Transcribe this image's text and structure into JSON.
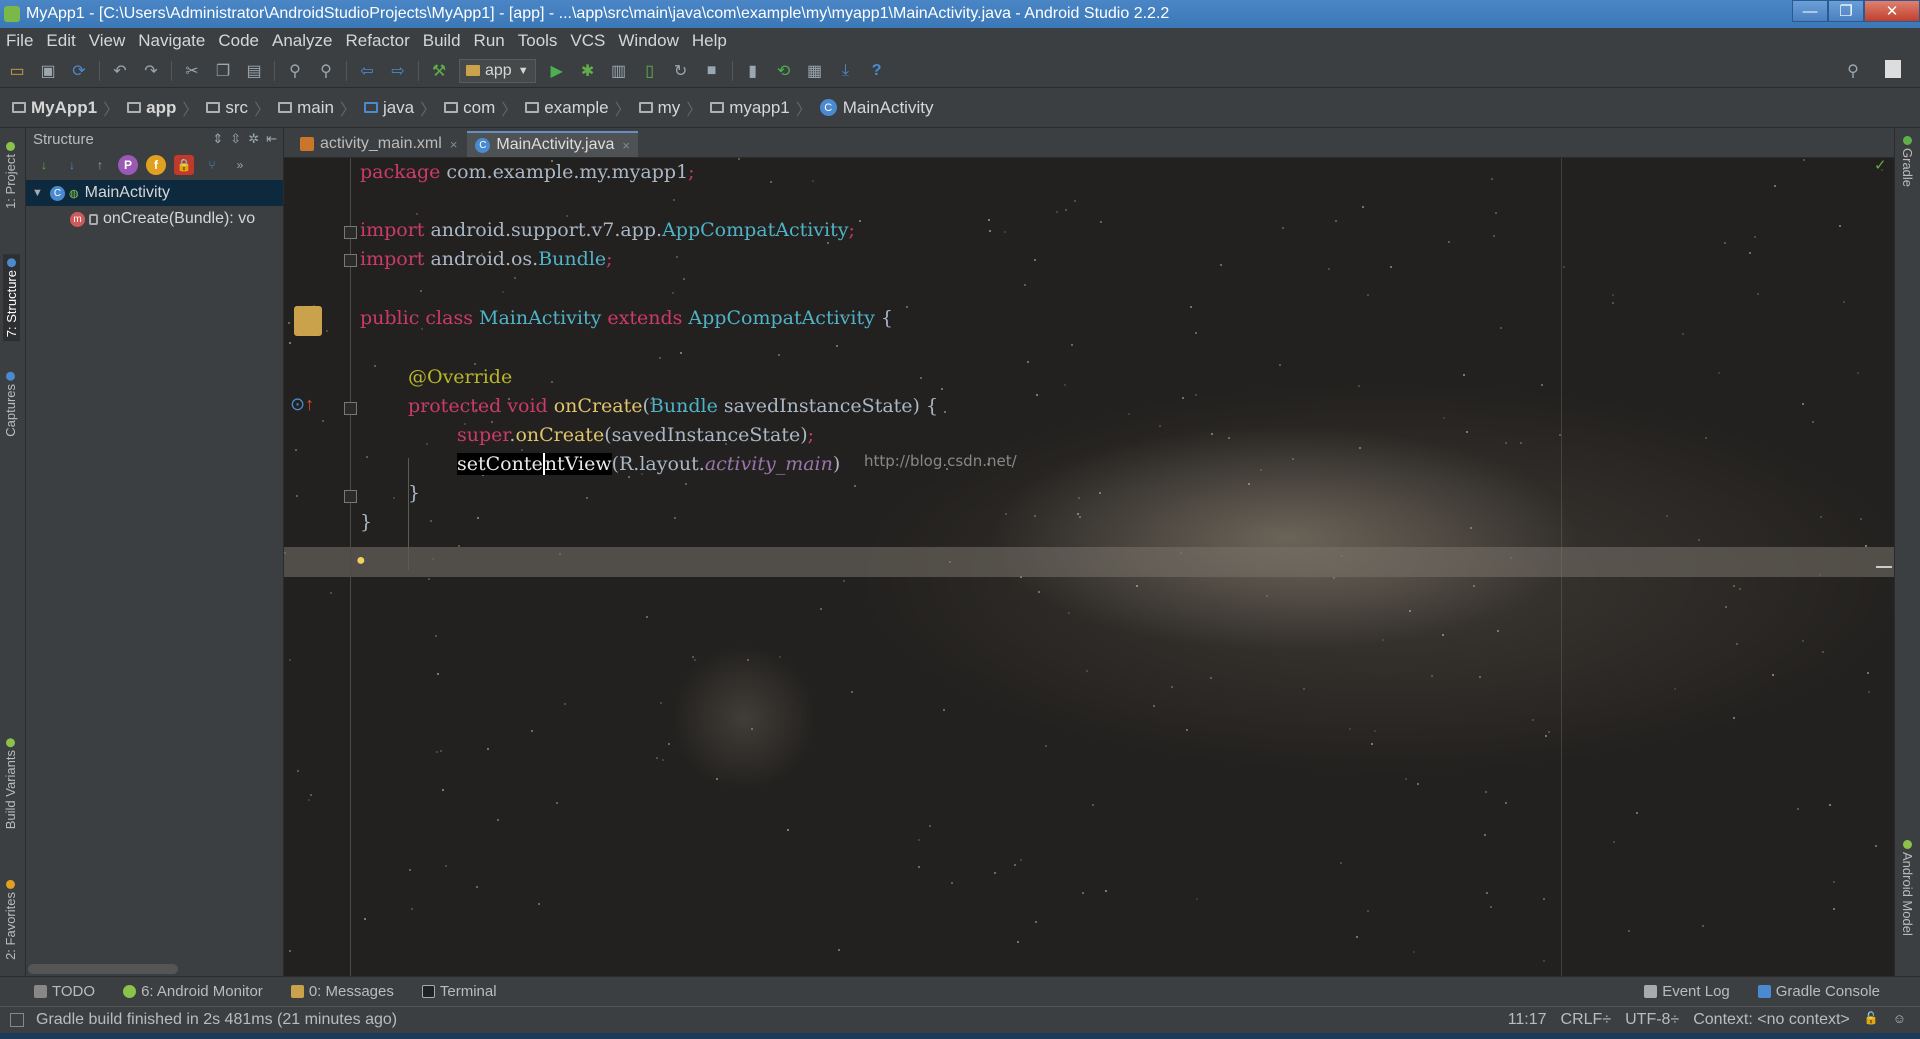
{
  "window": {
    "title": "MyApp1 - [C:\\Users\\Administrator\\AndroidStudioProjects\\MyApp1] - [app] - ...\\app\\src\\main\\java\\com\\example\\my\\myapp1\\MainActivity.java - Android Studio 2.2.2",
    "minimize": "—",
    "maximize": "❐",
    "close": "✕"
  },
  "menu": [
    "File",
    "Edit",
    "View",
    "Navigate",
    "Code",
    "Analyze",
    "Refactor",
    "Build",
    "Run",
    "Tools",
    "VCS",
    "Window",
    "Help"
  ],
  "toolbar": {
    "run_config": "app",
    "icons": [
      "open-icon",
      "save-icon",
      "sync-icon",
      "undo-icon",
      "redo-icon",
      "cut-icon",
      "copy-icon",
      "paste-icon",
      "find-icon",
      "replace-icon",
      "back-icon",
      "forward-icon",
      "make-icon",
      "run-icon",
      "debug-icon",
      "attach-icon",
      "stop-icon",
      "sdk-manager-icon",
      "help-icon"
    ],
    "help": "?"
  },
  "breadcrumb": [
    "MyApp1",
    "app",
    "src",
    "main",
    "java",
    "com",
    "example",
    "my",
    "myapp1",
    "MainActivity"
  ],
  "left_stripe": {
    "project": "1: Project",
    "structure": "7: Structure",
    "captures": "Captures",
    "build_variants": "Build Variants",
    "favorites": "2: Favorites"
  },
  "right_stripe": {
    "gradle": "Gradle",
    "android_model": "Android Model"
  },
  "structure": {
    "title": "Structure",
    "tree": {
      "class_name": "MainActivity",
      "method": "onCreate(Bundle): vo"
    }
  },
  "tabs": [
    {
      "label": "activity_main.xml",
      "close": "×"
    },
    {
      "label": "MainActivity.java",
      "close": "×"
    }
  ],
  "code": {
    "l1_kw": "package",
    "l1_rest": " com.example.my.myapp1",
    "l1_semi": ";",
    "l2_kw": "import",
    "l2_rest": " android.support.v7.app.",
    "l2_cls": "AppCompatActivity",
    "l2_semi": ";",
    "l3_kw": "import",
    "l3_rest": " android.os.",
    "l3_cls": "Bundle",
    "l3_semi": ";",
    "l4_kw1": "public class",
    "l4_cls1": " MainActivity",
    "l4_kw2": " extends",
    "l4_cls2": " AppCompatActivity",
    "l4_brace": " {",
    "l5_annot": "@Override",
    "l6_kw": "protected void",
    "l6_fn": " onCreate",
    "l6_paren": "(",
    "l6_cls": "Bundle",
    "l6_rest": " savedInstanceState) {",
    "l7_kw": "super",
    "l7_dot": ".",
    "l7_fn": "onCreate",
    "l7_rest": "(savedInstanceState)",
    "l7_semi": ";",
    "l8_sel1": "setConte",
    "l8_sel2": "ntView",
    "l8_rest": "(R.layout.",
    "l8_it": "activity_main",
    "l8_end": ")",
    "watermark": "http://blog.csdn.net/",
    "l9": "}",
    "l10": "}"
  },
  "bottom_tools": {
    "todo": "TODO",
    "android_monitor": "6: Android Monitor",
    "messages": "0: Messages",
    "terminal": "Terminal",
    "event_log": "Event Log",
    "gradle_console": "Gradle Console"
  },
  "status": {
    "message": "Gradle build finished in 2s 481ms (21 minutes ago)",
    "position": "11:17",
    "line_sep": "CRLF÷",
    "encoding": "UTF-8÷",
    "context": "Context: <no context>"
  },
  "colors": {
    "keyword": "#cc3a6c",
    "class": "#4fb3c8",
    "annotation": "#bbb529",
    "method": "#e0c46c",
    "field_italic": "#9876aa",
    "panel_bg": "#3c3f41",
    "title_bar": "#3b78b8"
  }
}
